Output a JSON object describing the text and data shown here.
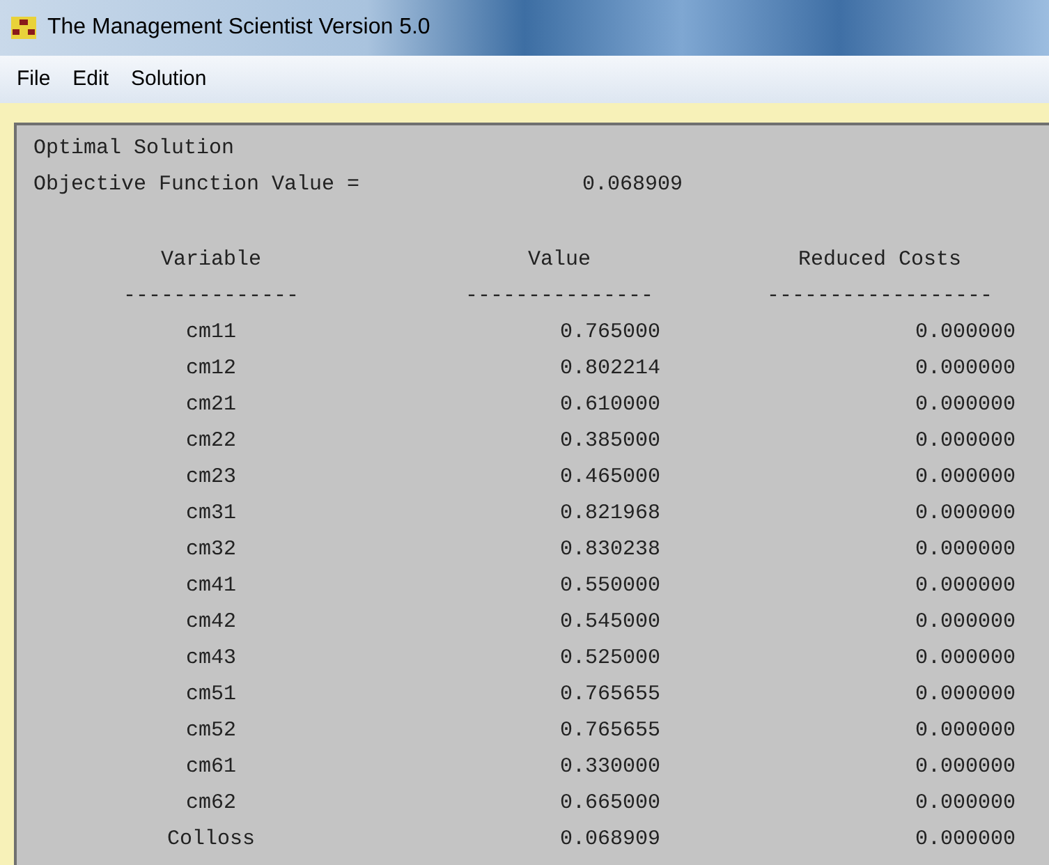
{
  "window": {
    "title": "The Management Scientist Version 5.0"
  },
  "menu": [
    "File",
    "Edit",
    "Solution"
  ],
  "output": {
    "heading": "Optimal Solution",
    "objective_label": "Objective Function Value =",
    "objective_value": "0.068909",
    "columns": [
      "Variable",
      "Value",
      "Reduced Costs"
    ],
    "underlines": [
      "--------------",
      "---------------",
      "------------------"
    ],
    "rows": [
      {
        "variable": "cm11",
        "value": "0.765000",
        "reduced_cost": "0.000000"
      },
      {
        "variable": "cm12",
        "value": "0.802214",
        "reduced_cost": "0.000000"
      },
      {
        "variable": "cm21",
        "value": "0.610000",
        "reduced_cost": "0.000000"
      },
      {
        "variable": "cm22",
        "value": "0.385000",
        "reduced_cost": "0.000000"
      },
      {
        "variable": "cm23",
        "value": "0.465000",
        "reduced_cost": "0.000000"
      },
      {
        "variable": "cm31",
        "value": "0.821968",
        "reduced_cost": "0.000000"
      },
      {
        "variable": "cm32",
        "value": "0.830238",
        "reduced_cost": "0.000000"
      },
      {
        "variable": "cm41",
        "value": "0.550000",
        "reduced_cost": "0.000000"
      },
      {
        "variable": "cm42",
        "value": "0.545000",
        "reduced_cost": "0.000000"
      },
      {
        "variable": "cm43",
        "value": "0.525000",
        "reduced_cost": "0.000000"
      },
      {
        "variable": "cm51",
        "value": "0.765655",
        "reduced_cost": "0.000000"
      },
      {
        "variable": "cm52",
        "value": "0.765655",
        "reduced_cost": "0.000000"
      },
      {
        "variable": "cm61",
        "value": "0.330000",
        "reduced_cost": "0.000000"
      },
      {
        "variable": "cm62",
        "value": "0.665000",
        "reduced_cost": "0.000000"
      },
      {
        "variable": "Colloss",
        "value": "0.068909",
        "reduced_cost": "0.000000"
      }
    ]
  }
}
